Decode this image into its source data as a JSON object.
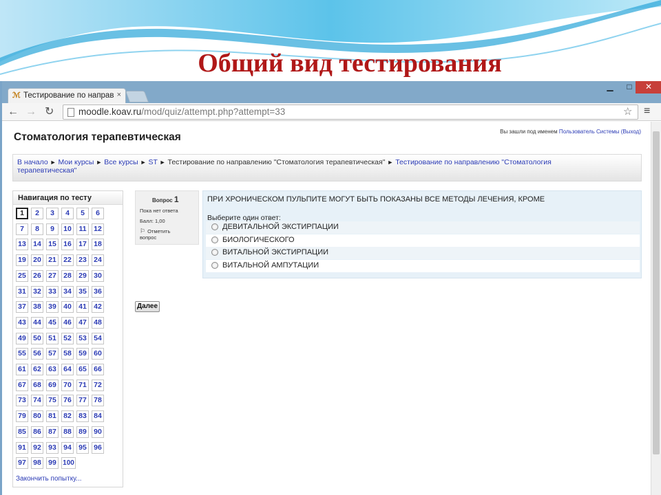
{
  "slide": {
    "title": "Общий вид тестирования"
  },
  "browser": {
    "tab_title": "Тестирование по направ",
    "tab_close": "×",
    "url_host": "moodle.koav.ru",
    "url_path": "/mod/quiz/attempt.php?attempt=33",
    "window_buttons": {
      "minimize": "▁",
      "maximize": "□",
      "close": "✕"
    },
    "nav": {
      "back": "←",
      "forward": "→",
      "reload": "↻",
      "star": "☆",
      "menu": "≡"
    }
  },
  "page": {
    "course_title": "Стоматология терапевтическая",
    "login_prefix": "Вы зашли под именем",
    "login_user": "Пользователь Системы",
    "login_logout": "(Выход)",
    "breadcrumb": {
      "home": "В начало",
      "my_courses": "Мои курсы",
      "all_courses": "Все курсы",
      "st": "ST",
      "current": "Тестирование по направлению \"Стоматология терапевтическая\"",
      "link_line1": "Тестирование по направлению \"Стоматология",
      "link_line2": "терапевтическая\"",
      "separator": "►"
    },
    "quiz_nav": {
      "title": "Навигация по тесту",
      "current_question": 1,
      "questions": [
        "1",
        "2",
        "3",
        "4",
        "5",
        "6",
        "7",
        "8",
        "9",
        "10",
        "11",
        "12",
        "13",
        "14",
        "15",
        "16",
        "17",
        "18",
        "19",
        "20",
        "21",
        "22",
        "23",
        "24",
        "25",
        "26",
        "27",
        "28",
        "29",
        "30",
        "31",
        "32",
        "33",
        "34",
        "35",
        "36",
        "37",
        "38",
        "39",
        "40",
        "41",
        "42",
        "43",
        "44",
        "45",
        "46",
        "47",
        "48",
        "49",
        "50",
        "51",
        "52",
        "53",
        "54",
        "55",
        "56",
        "57",
        "58",
        "59",
        "60",
        "61",
        "62",
        "63",
        "64",
        "65",
        "66",
        "67",
        "68",
        "69",
        "70",
        "71",
        "72",
        "73",
        "74",
        "75",
        "76",
        "77",
        "78",
        "79",
        "80",
        "81",
        "82",
        "83",
        "84",
        "85",
        "86",
        "87",
        "88",
        "89",
        "90",
        "91",
        "92",
        "93",
        "94",
        "95",
        "96",
        "97",
        "98",
        "99",
        "100"
      ],
      "finish_link": "Закончить попытку..."
    },
    "question_info": {
      "label": "Вопрос",
      "number": "1",
      "state": "Пока нет ответа",
      "grade": "Балл: 1,00",
      "flag_line1": "Отметить",
      "flag_line2": "вопрос",
      "flag_icon": "⚐"
    },
    "question": {
      "text": "ПРИ ХРОНИЧЕСКОМ ПУЛЬПИТЕ МОГУТ БЫТЬ ПОКАЗАНЫ ВСЕ МЕТОДЫ ЛЕЧЕНИЯ, КРОМЕ",
      "prompt": "Выберите один ответ:",
      "answers": [
        "ДЕВИТАЛЬНОЙ ЭКСТИРПАЦИИ",
        "БИОЛОГИЧЕСКОГО",
        "ВИТАЛЬНОЙ ЭКСТИРПАЦИИ",
        "ВИТАЛЬНОЙ АМПУТАЦИИ"
      ]
    },
    "next_button": "Далее"
  }
}
